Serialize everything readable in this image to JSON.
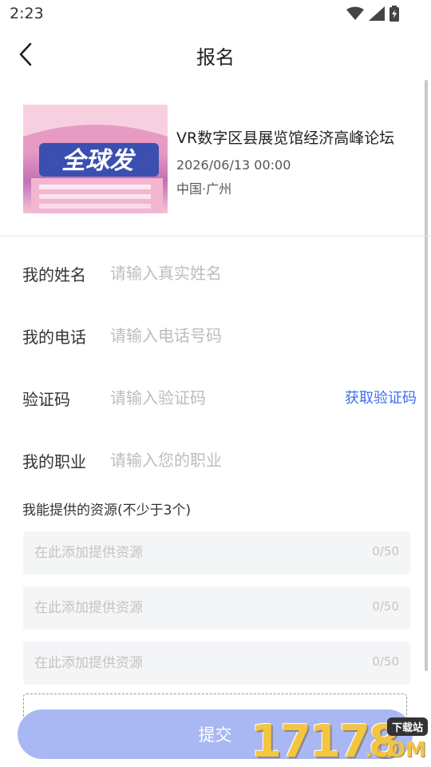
{
  "status_bar": {
    "time": "2:23"
  },
  "nav": {
    "title": "报名"
  },
  "event": {
    "title": "VR数字区县展览馆经济高峰论坛",
    "date": "2026/06/13 00:00",
    "location": "中国·广州",
    "image_text": "全球发"
  },
  "form": {
    "name": {
      "label": "我的姓名",
      "placeholder": "请输入真实姓名",
      "value": ""
    },
    "phone": {
      "label": "我的电话",
      "placeholder": "请输入电话号码",
      "value": ""
    },
    "code": {
      "label": "验证码",
      "placeholder": "请输入验证码",
      "value": "",
      "button": "获取验证码"
    },
    "job": {
      "label": "我的职业",
      "placeholder": "请输入您的职业",
      "value": ""
    }
  },
  "resources": {
    "heading": "我能提供的资源(不少于3个)",
    "items": [
      {
        "placeholder": "在此添加提供资源",
        "count": "0/50"
      },
      {
        "placeholder": "在此添加提供资源",
        "count": "0/50"
      },
      {
        "placeholder": "在此添加提供资源",
        "count": "0/50"
      }
    ]
  },
  "submit": {
    "label": "提交"
  },
  "watermark": {
    "digits": "17178",
    "tag": "下载站",
    "suffix": ".COM"
  },
  "colors": {
    "accent": "#3b6ff0",
    "submit_bg": "#a9b8f3",
    "input_bg": "#f4f5f7"
  }
}
